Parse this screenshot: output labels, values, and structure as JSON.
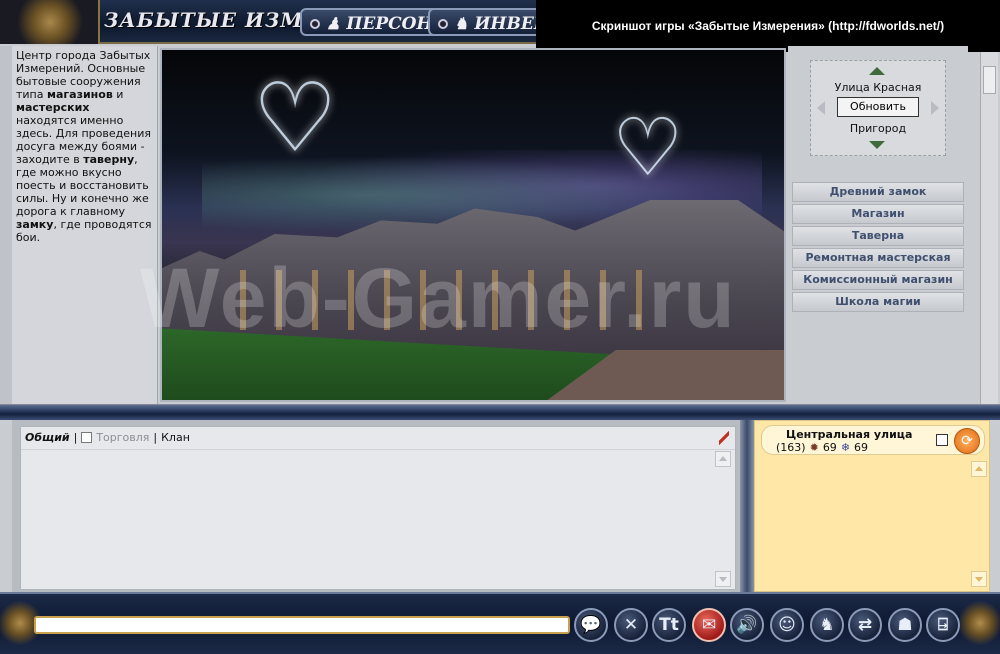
{
  "header": {
    "logo_title": "ЗАБЫТЫЕ ИЗМЕРЕНИЯ",
    "tabs": [
      {
        "label": "ПЕРСОНАЖ"
      },
      {
        "label": "ИНВЕНТАР"
      }
    ],
    "caption": "Скриншот игры «Забытые Измерения»  (http://fdworlds.net/)"
  },
  "description": {
    "p1": "Центр города Забытых Измерений. Основные бытовые сооружения типа ",
    "b1": "магазинов",
    "p2": " и ",
    "b2": "мастерских",
    "p3": " находятся именно здесь. Для проведения досуга между боями - заходите в ",
    "b3": "таверну",
    "p4": ", где можно вкусно поесть и восстановить силы. Ну и конечно же дорога к главному ",
    "b4": "замку",
    "p5": ", где проводятся бои."
  },
  "scene": {
    "watermark": "Web-Gamer.ru"
  },
  "navigation": {
    "north_street": "Улица Красная",
    "refresh_label": "Обновить",
    "south_street": "Пригород",
    "locations": [
      {
        "label": "Древний замок"
      },
      {
        "label": "Магазин"
      },
      {
        "label": "Таверна"
      },
      {
        "label": "Ремонтная мастерская"
      },
      {
        "label": "Комиссионный магазин"
      },
      {
        "label": "Школа магии"
      }
    ]
  },
  "chat": {
    "tab_general": "Общий",
    "sep": "|",
    "tab_trade": "Торговля",
    "tab_clan": "Клан",
    "input_value": ""
  },
  "players": {
    "location": "Центральная улица",
    "count": "(163)",
    "stat1": "69",
    "stat2": "69"
  },
  "toolbar": {
    "icons": [
      "speech-bubble-icon",
      "close-icon",
      "text-format-icon",
      "mail-icon",
      "sound-icon",
      "smiley-icon",
      "bag-icon",
      "transfer-icon",
      "user-icon",
      "exit-icon"
    ],
    "glyphs": {
      "speech": "💬",
      "close": "✕",
      "text": "Tt",
      "mail": "✉",
      "sound": "🔊",
      "smile": "☺",
      "bag": "♞",
      "transfer": "⇄",
      "user": "☗",
      "exit": "⍈"
    }
  },
  "colors": {
    "active_tool": "#c8281e",
    "players_bg": "#ffe7a8",
    "loc_text": "#3f4f6e"
  }
}
